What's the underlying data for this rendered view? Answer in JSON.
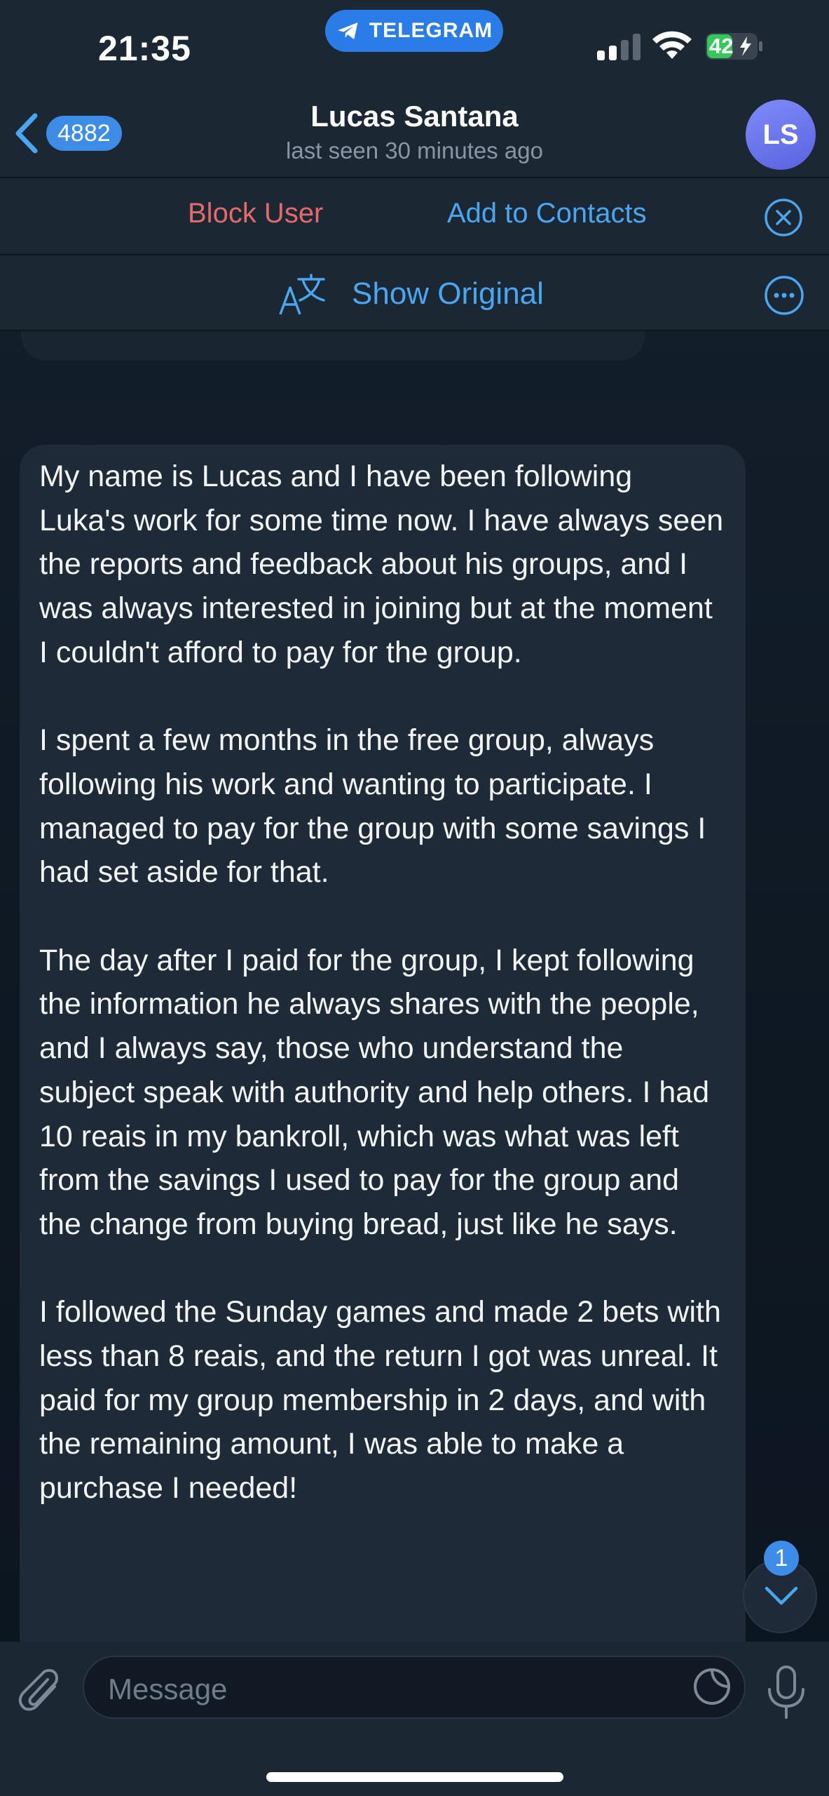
{
  "status_bar": {
    "time": "21:35",
    "app_pill": "TELEGRAM",
    "battery": "42"
  },
  "header": {
    "back_count": "4882",
    "name": "Lucas Santana",
    "last_seen": "last seen 30 minutes ago",
    "avatar_initials": "LS"
  },
  "actions": {
    "block_user": "Block User",
    "add_contacts": "Add to Contacts"
  },
  "translation": {
    "show_original": "Show Original"
  },
  "message": {
    "paragraphs": [
      "My name is Lucas and I have been following Luka's work for some time now. I have always seen the reports and feedback about his groups, and I was always interested in joining but at the moment I couldn't afford to pay for the group.",
      "I spent a few months in the free group, always following his work and wanting to participate. I managed to pay for the group with some savings I had set aside for that.",
      "The day after I paid for the group, I kept following the information he always shares with the people, and I always say, those who understand the subject speak with authority and help others. I had 10 reais in my bankroll, which was what was left from the savings I used to pay for the group and the change from buying bread, just like he says.",
      "I followed the Sunday games and made 2 bets with less than 8 reais, and the return I got was unreal. It paid for my group membership in 2 days, and with the remaining amount, I was able to make a purchase I needed!"
    ]
  },
  "scroll": {
    "unread_count": "1"
  },
  "composer": {
    "placeholder": "Message"
  },
  "colors": {
    "accent": "#4aa6f0",
    "danger": "#e36a6a",
    "bar_bg": "#1c2734",
    "bubble_bg": "#1e2a38"
  }
}
